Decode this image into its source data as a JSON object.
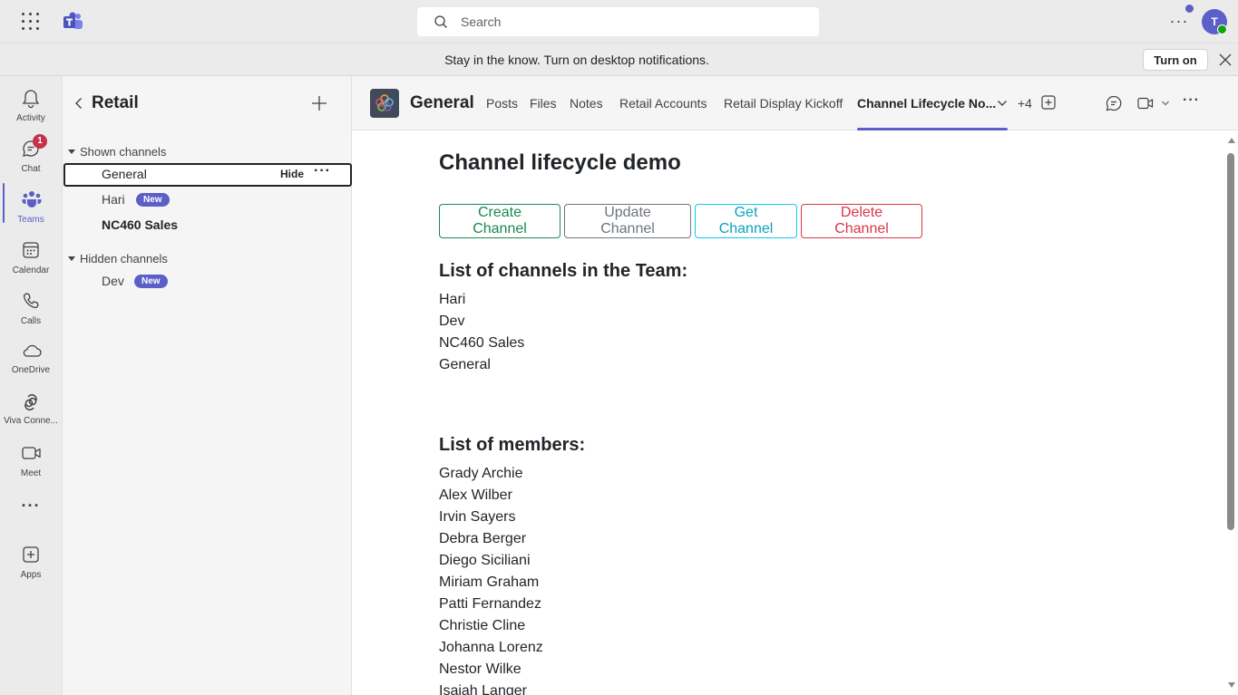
{
  "topbar": {
    "search_placeholder": "Search",
    "more_label": "···",
    "avatar_initial": "T"
  },
  "notification": {
    "message": "Stay in the know. Turn on desktop notifications.",
    "turn_on_label": "Turn on"
  },
  "rail": {
    "items": [
      {
        "label": "Activity",
        "icon": "bell-icon"
      },
      {
        "label": "Chat",
        "icon": "chat-icon",
        "badge": "1"
      },
      {
        "label": "Teams",
        "icon": "teams-icon",
        "active": true
      },
      {
        "label": "Calendar",
        "icon": "calendar-icon"
      },
      {
        "label": "Calls",
        "icon": "phone-icon"
      },
      {
        "label": "OneDrive",
        "icon": "cloud-icon"
      },
      {
        "label": "Viva Conne...",
        "icon": "viva-connections-icon"
      },
      {
        "label": "Meet",
        "icon": "video-icon"
      },
      {
        "label": "···",
        "icon": "more-apps-icon"
      },
      {
        "label": "Apps",
        "icon": "apps-add-icon"
      }
    ]
  },
  "panel": {
    "team_name": "Retail",
    "shown_heading": "Shown channels",
    "hidden_heading": "Hidden channels",
    "shown_channels": [
      {
        "name": "General",
        "hide_label": "Hide",
        "more": "···"
      },
      {
        "name": "Hari",
        "badge": "New"
      },
      {
        "name": "NC460 Sales"
      }
    ],
    "hidden_channels": [
      {
        "name": "Dev",
        "badge": "New"
      }
    ]
  },
  "channel_header": {
    "title": "General",
    "tabs": [
      "Posts",
      "Files",
      "Notes",
      "Retail Accounts",
      "Retail Display Kickoff",
      "Channel Lifecycle No..."
    ],
    "more_tabs": "+4",
    "active_tab": "Channel Lifecycle No..."
  },
  "content": {
    "title": "Channel lifecycle demo",
    "buttons": {
      "create": "Create Channel",
      "update": "Update Channel",
      "get": "Get Channel",
      "delete": "Delete Channel"
    },
    "channels_heading": "List of channels in the Team:",
    "channels": [
      "Hari",
      "Dev",
      "NC460 Sales",
      "General"
    ],
    "members_heading": "List of members:",
    "members": [
      "Grady Archie",
      "Alex Wilber",
      "Irvin Sayers",
      "Debra Berger",
      "Diego Siciliani",
      "Miriam Graham",
      "Patti Fernandez",
      "Christie Cline",
      "Johanna Lorenz",
      "Nestor Wilke",
      "Isaiah Langer"
    ]
  },
  "colors": {
    "accent": "#5b5fc7",
    "success": "#198754",
    "secondary": "#6c757d",
    "info": "#0dcaf0",
    "danger": "#dc3545",
    "badge_red": "#c4314b"
  }
}
